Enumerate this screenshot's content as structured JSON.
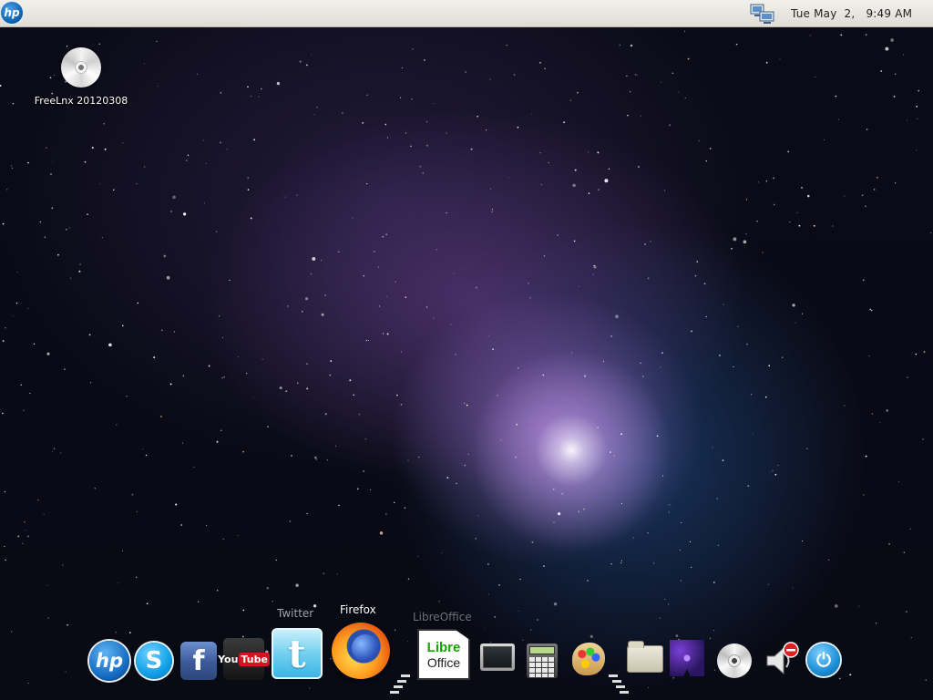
{
  "top_panel": {
    "menu_icon": "hp-logo-icon",
    "network_icon": "network-icon",
    "clock": "Tue May  2,   9:49 AM"
  },
  "desktop": {
    "icons": [
      {
        "label": "FreeLnx 20120308",
        "icon": "disc-icon"
      }
    ]
  },
  "dock": {
    "visible_labels": {
      "twitter": "Twitter",
      "firefox": "Firefox",
      "libreoffice": "LibreOffice"
    },
    "items": [
      {
        "id": "hp",
        "icon": "hp-logo-icon",
        "glyph": "hp"
      },
      {
        "id": "skype",
        "icon": "skype-icon",
        "glyph": "S"
      },
      {
        "id": "facebook",
        "icon": "facebook-icon",
        "glyph": "f"
      },
      {
        "id": "youtube",
        "icon": "youtube-icon",
        "glyph_you": "You",
        "glyph_tube": "Tube"
      },
      {
        "id": "twitter",
        "icon": "twitter-icon",
        "glyph": "t"
      },
      {
        "id": "firefox",
        "icon": "firefox-icon"
      },
      {
        "id": "libreoffice",
        "icon": "libreoffice-icon",
        "glyph_line1": "Libre",
        "glyph_line2": "Office"
      },
      {
        "id": "terminal",
        "icon": "terminal-icon"
      },
      {
        "id": "calculator",
        "icon": "calculator-icon"
      },
      {
        "id": "paint",
        "icon": "paint-palette-icon"
      },
      {
        "id": "files",
        "icon": "folder-icon"
      },
      {
        "id": "space",
        "icon": "space-game-icon"
      },
      {
        "id": "cd",
        "icon": "cd-icon"
      },
      {
        "id": "volume",
        "icon": "volume-muted-icon"
      },
      {
        "id": "power",
        "icon": "power-icon",
        "glyph": "⏻"
      }
    ]
  },
  "colors": {
    "panel_bg": "#ebe9e4",
    "wallpaper_glow": "#c8a0f0",
    "firefox_label": "#ffffff",
    "twitter_label": "#9aa6b2",
    "libre_label": "#6d7580"
  }
}
